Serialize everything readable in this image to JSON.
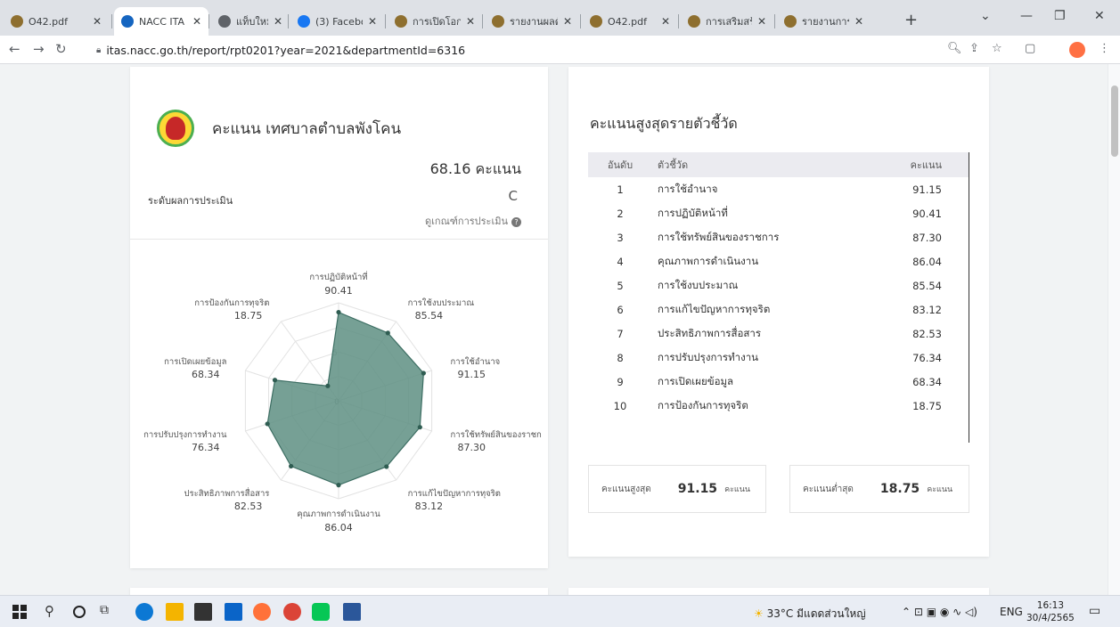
{
  "browser": {
    "tabs": [
      {
        "label": "O42.pdf",
        "color": "#8e6f2f",
        "active": false
      },
      {
        "label": "NACC ITA",
        "color": "#1565c0",
        "active": true
      },
      {
        "label": "แท็บใหม่",
        "color": "#5f6368",
        "active": false
      },
      {
        "label": "(3) Facebo",
        "color": "#1877f2",
        "active": false
      },
      {
        "label": "การเปิดโอกา",
        "color": "#8e6f2f",
        "active": false
      },
      {
        "label": "รายงานผลดั",
        "color": "#8e6f2f",
        "active": false
      },
      {
        "label": "O42.pdf",
        "color": "#8e6f2f",
        "active": false
      },
      {
        "label": "การเสริมสร้า",
        "color": "#8e6f2f",
        "active": false
      },
      {
        "label": "รายงานการ",
        "color": "#8e6f2f",
        "active": false
      }
    ],
    "url": "itas.nacc.go.th/report/rpt0201?year=2021&departmentId=6316"
  },
  "left_card": {
    "title": "คะแนน เทศบาลตำบลพังโคน",
    "score_text": "68.16 คะแนน",
    "level_label": "ระดับผลการประเมิน",
    "level_value": "C",
    "criteria_link": "ดูเกณฑ์การประเมิน"
  },
  "chart_data": {
    "type": "radar",
    "range": [
      0,
      100
    ],
    "ring_labels": [
      "0",
      "5"
    ],
    "fill_color": "#5e8f82",
    "axes": [
      {
        "label": "การปฏิบัติหน้าที่",
        "value": 90.41,
        "value_text": "90.41"
      },
      {
        "label": "การใช้งบประมาณ",
        "value": 85.54,
        "value_text": "85.54"
      },
      {
        "label": "การใช้อำนาจ",
        "value": 91.15,
        "value_text": "91.15"
      },
      {
        "label": "การใช้ทรัพย์สินของราชก",
        "value": 87.3,
        "value_text": "87.30"
      },
      {
        "label": "การแก้ไขปัญหาการทุจริต",
        "value": 83.12,
        "value_text": "83.12"
      },
      {
        "label": "คุณภาพการดำเนินงาน",
        "value": 86.04,
        "value_text": "86.04"
      },
      {
        "label": "ประสิทธิภาพการสื่อสาร",
        "value": 82.53,
        "value_text": "82.53"
      },
      {
        "label": "การปรับปรุงการทำงาน",
        "value": 76.34,
        "value_text": "76.34"
      },
      {
        "label": "การเปิดเผยข้อมูล",
        "value": 68.34,
        "value_text": "68.34"
      },
      {
        "label": "การป้องกันการทุจริต",
        "value": 18.75,
        "value_text": "18.75"
      }
    ]
  },
  "right_card": {
    "title": "คะแนนสูงสุดรายตัวชี้วัด",
    "headers": {
      "rank": "อันดับ",
      "indicator": "ตัวชี้วัด",
      "score": "คะแนน"
    },
    "rows": [
      {
        "rank": "1",
        "indicator": "การใช้อำนาจ",
        "score": "91.15"
      },
      {
        "rank": "2",
        "indicator": "การปฏิบัติหน้าที่",
        "score": "90.41"
      },
      {
        "rank": "3",
        "indicator": "การใช้ทรัพย์สินของราชการ",
        "score": "87.30"
      },
      {
        "rank": "4",
        "indicator": "คุณภาพการดำเนินงาน",
        "score": "86.04"
      },
      {
        "rank": "5",
        "indicator": "การใช้งบประมาณ",
        "score": "85.54"
      },
      {
        "rank": "6",
        "indicator": "การแก้ไขปัญหาการทุจริต",
        "score": "83.12"
      },
      {
        "rank": "7",
        "indicator": "ประสิทธิภาพการสื่อสาร",
        "score": "82.53"
      },
      {
        "rank": "8",
        "indicator": "การปรับปรุงการทำงาน",
        "score": "76.34"
      },
      {
        "rank": "9",
        "indicator": "การเปิดเผยข้อมูล",
        "score": "68.34"
      },
      {
        "rank": "10",
        "indicator": "การป้องกันการทุจริต",
        "score": "18.75"
      }
    ],
    "max_label": "คะแนนสูงสุด",
    "max_value": "91.15",
    "min_label": "คะแนนต่ำสุด",
    "min_value": "18.75",
    "unit": "คะแนน"
  },
  "taskbar": {
    "weather": "33°C มีแดดส่วนใหญ่",
    "lang": "ENG",
    "time": "16:13",
    "date": "30/4/2565"
  }
}
